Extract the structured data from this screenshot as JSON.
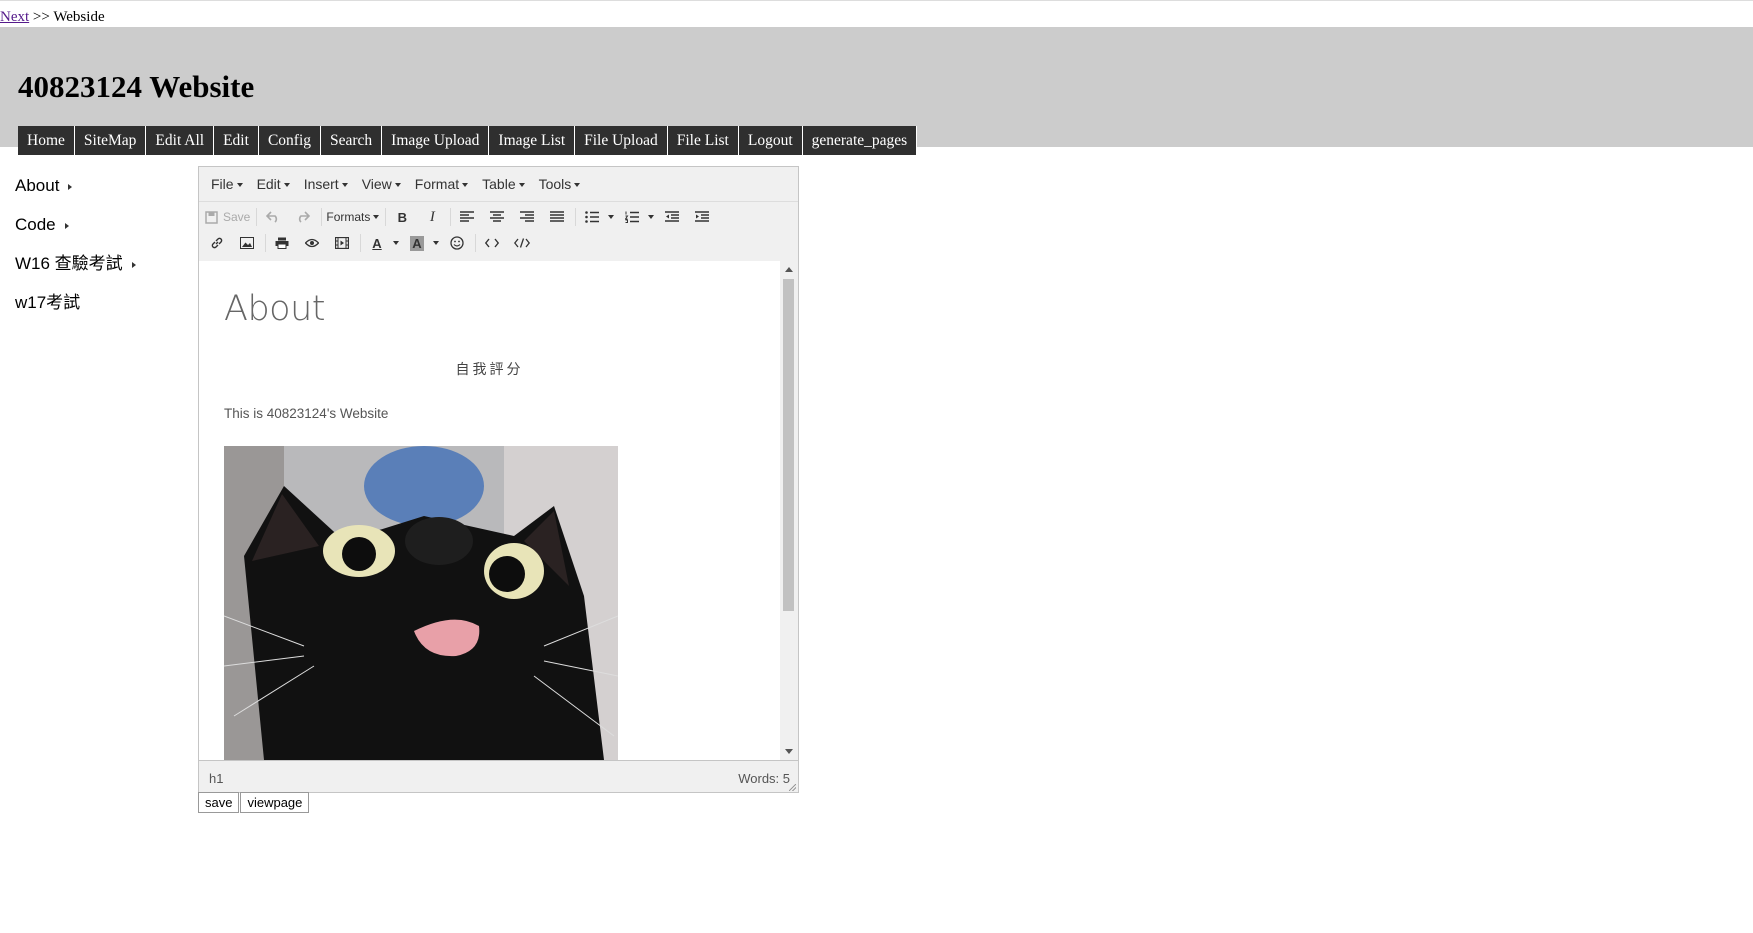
{
  "breadcrumb": {
    "link": "Next",
    "rest": ">> Webside"
  },
  "site": {
    "title": "40823124 Website"
  },
  "menu": [
    "Home",
    "SiteMap",
    "Edit All",
    "Edit",
    "Config",
    "Search",
    "Image Upload",
    "Image List",
    "File Upload",
    "File List",
    "Logout",
    "generate_pages"
  ],
  "sidebar": {
    "items": [
      {
        "label": "About",
        "has_children": true
      },
      {
        "label": "Code",
        "has_children": true
      },
      {
        "label": "W16 查驗考試",
        "has_children": true
      },
      {
        "label": "w17考試",
        "has_children": false
      }
    ]
  },
  "editor": {
    "menus": [
      "File",
      "Edit",
      "Insert",
      "View",
      "Format",
      "Table",
      "Tools"
    ],
    "toolbar": {
      "save": "Save",
      "formats": "Formats"
    },
    "content": {
      "heading": "About",
      "center_text": "自我評分",
      "paragraph": "This is 40823124's Website",
      "image_alt": "black cat sticking out tongue"
    },
    "status": {
      "path": "h1",
      "words": "Words: 5"
    }
  },
  "buttons": {
    "save": "save",
    "viewpage": "viewpage"
  },
  "colors": {
    "header_bg": "#cccccc",
    "menu_bg": "#2f2f2f",
    "menu_text": "#ffffff"
  }
}
